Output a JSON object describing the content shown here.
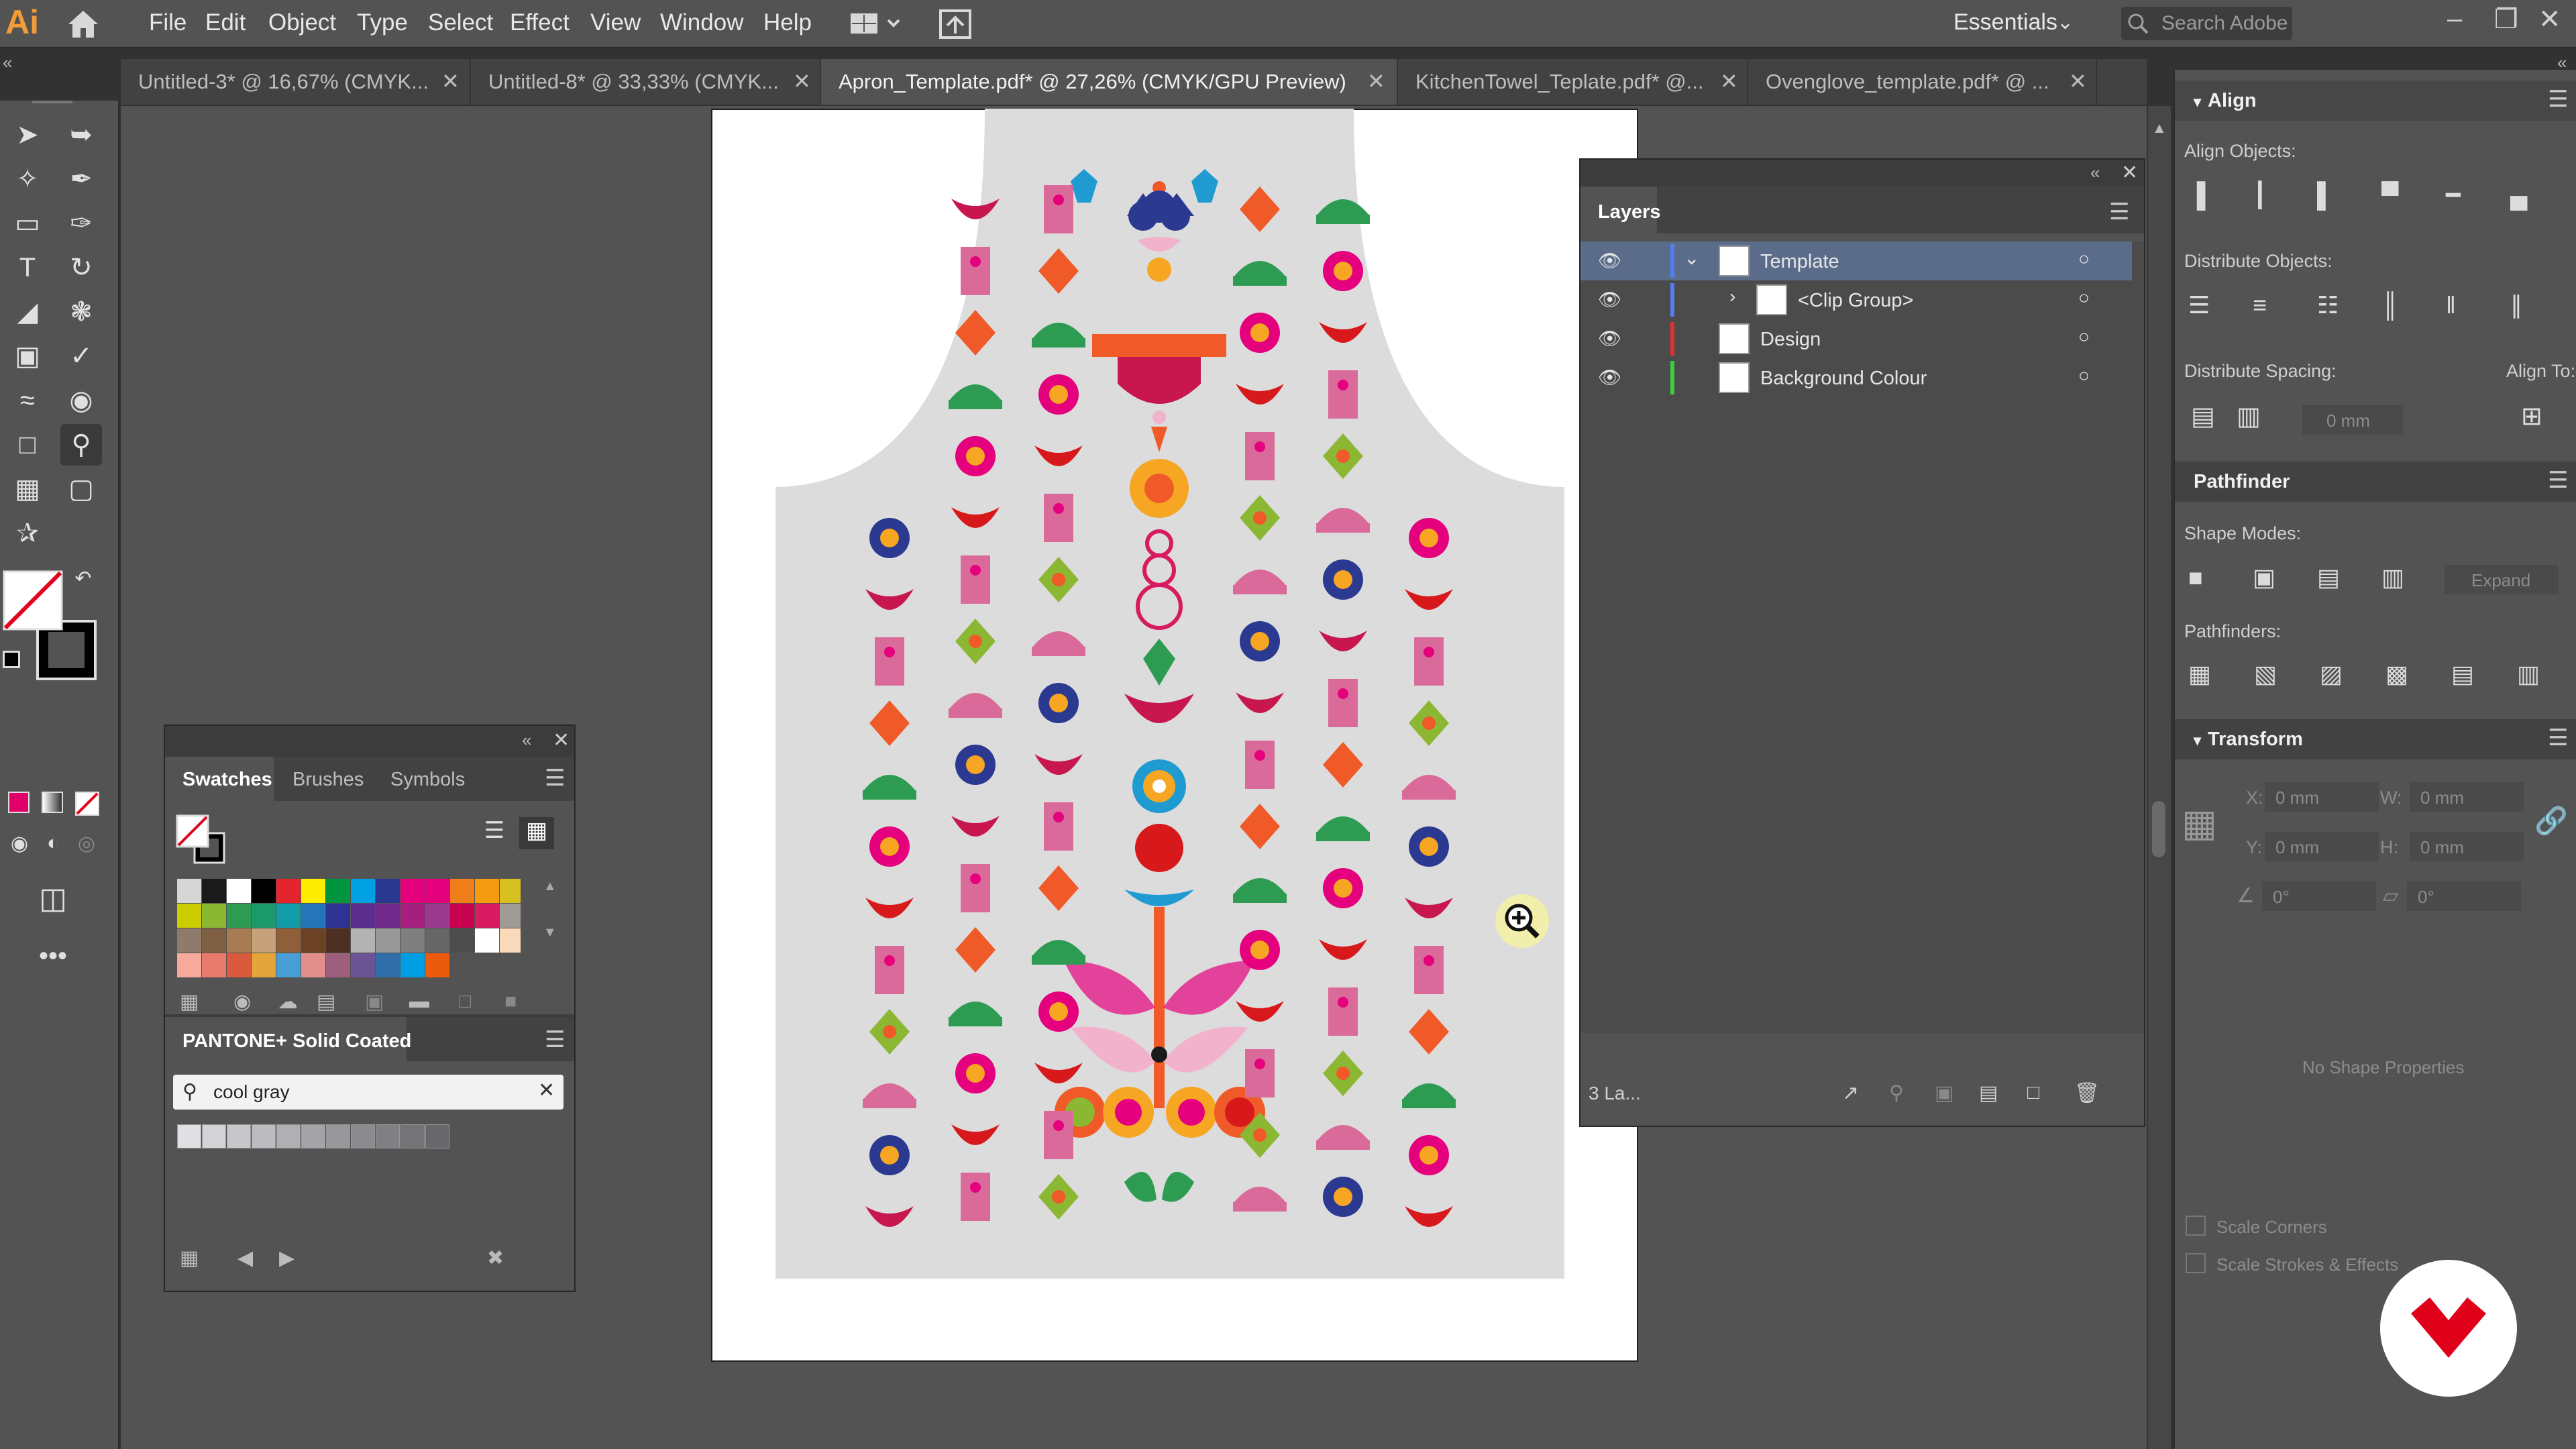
{
  "app": {
    "logo": "Ai"
  },
  "menu": [
    "File",
    "Edit",
    "Object",
    "Type",
    "Select",
    "Effect",
    "View",
    "Window",
    "Help"
  ],
  "workspace": "Essentials",
  "search_placeholder": "Search Adobe",
  "tabs": [
    {
      "label": "Untitled-3* @ 16,67% (CMYK..."
    },
    {
      "label": "Untitled-8* @ 33,33% (CMYK..."
    },
    {
      "label": "Apron_Template.pdf* @ 27,26% (CMYK/GPU Preview)"
    },
    {
      "label": "KitchenTowel_Teplate.pdf* @..."
    },
    {
      "label": "Ovenglove_template.pdf* @ ..."
    }
  ],
  "swatches_panel": {
    "tabs": [
      "Swatches",
      "Brushes",
      "Symbols"
    ],
    "colors": [
      "#d6d6d6",
      "#1a1a1a",
      "#ffffff",
      "#000000",
      "#e4252e",
      "#ffed00",
      "#00963f",
      "#00a0e3",
      "#2b3990",
      "#e5007e",
      "#e5007e",
      "#ee7f1a",
      "#f39c12",
      "#d8c021",
      "#cccc00",
      "#8bb733",
      "#2e9b52",
      "#1d9a6c",
      "#129ba8",
      "#2575b9",
      "#2e3393",
      "#5b2d8c",
      "#6f2a8c",
      "#a61f7f",
      "#9b3b8f",
      "#c7004f",
      "#d81b60",
      "#9e9c94",
      "#8e7b6c",
      "#7f5f44",
      "#a87c52",
      "#c5a27a",
      "#8f5f3a",
      "#6b4226",
      "#4e3022",
      "#b3b3b3",
      "#999999",
      "#7f7f7f",
      "#666666",
      "#4d4d4d",
      "#ffffff",
      "#f9d9b8",
      "#f7aa9b",
      "#e87b6b",
      "#d95a3c",
      "#e4a63b",
      "#4a9ed6",
      "#e28e8a",
      "#9e5f7e",
      "#6a5493",
      "#2f6ea8",
      "#009fe3",
      "#ea5b0c"
    ],
    "library_title": "PANTONE+ Solid Coated",
    "search_value": "cool gray",
    "gray_count": 11
  },
  "layers_panel": {
    "title": "Layers",
    "rows": [
      {
        "name": "Template",
        "color": "#4f7ff0"
      },
      {
        "name": "<Clip Group>",
        "color": "#4f7ff0"
      },
      {
        "name": "Design",
        "color": "#e0322c"
      },
      {
        "name": "Background Colour",
        "color": "#3ccf3c"
      }
    ],
    "footer": "3 La..."
  },
  "align_panel": {
    "title": "Align",
    "align_objects": "Align Objects:",
    "distribute_objects": "Distribute Objects:",
    "distribute_spacing": "Distribute Spacing:",
    "align_to": "Align To:",
    "spacing_value": "0 mm"
  },
  "pathfinder_panel": {
    "title": "Pathfinder",
    "shape_modes": "Shape Modes:",
    "expand": "Expand",
    "pathfinders": "Pathfinders:"
  },
  "transform_panel": {
    "title": "Transform",
    "x_label": "X:",
    "x_value": "0 mm",
    "y_label": "Y:",
    "y_value": "0 mm",
    "w_label": "W:",
    "w_value": "0 mm",
    "h_label": "H:",
    "h_value": "0 mm",
    "angle_value": "0°",
    "shear_value": "0°",
    "no_shape": "No Shape Properties",
    "scale_corners": "Scale Corners",
    "scale_strokes": "Scale Strokes & Effects"
  },
  "colors": {
    "accent": "#f29c38",
    "apron_bg": "#dcdcdc",
    "brand": "#e1001a"
  }
}
